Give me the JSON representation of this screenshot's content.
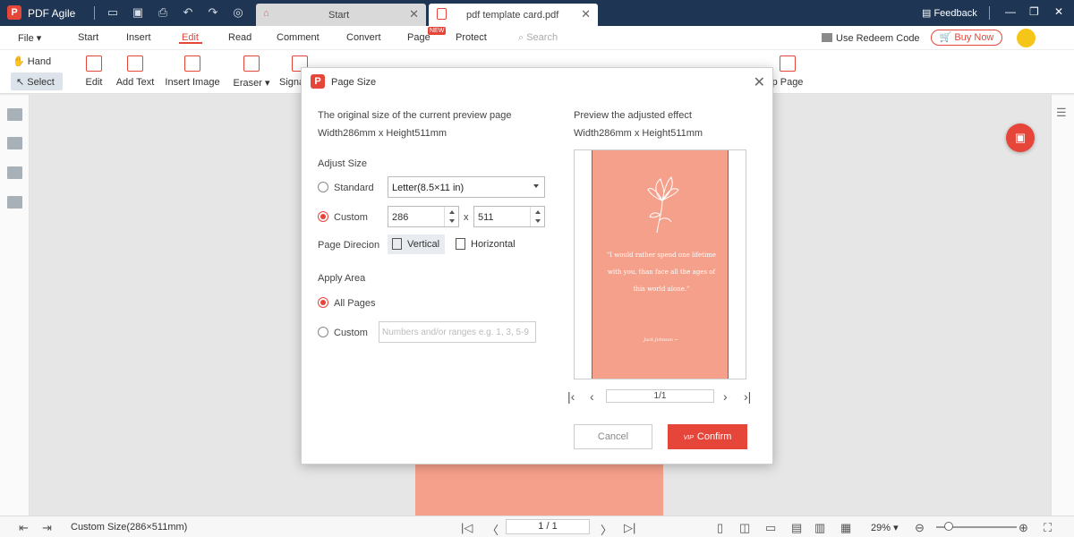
{
  "app": {
    "name": "PDF Agile",
    "logo": "P"
  },
  "tabs": [
    {
      "label": "Start"
    },
    {
      "label": "pdf template card.pdf"
    }
  ],
  "titlebar": {
    "feedback_label": "Feedback"
  },
  "menu": {
    "items": [
      "File",
      "Start",
      "Insert",
      "Edit",
      "Read",
      "Comment",
      "Convert",
      "Page",
      "Protect"
    ],
    "active": "Edit",
    "new_badge": "NEW",
    "search_placeholder": "Search",
    "redeem_label": "Use Redeem Code",
    "buy_label": "Buy Now"
  },
  "toolbar": {
    "hand_label": "Hand",
    "select_label": "Select",
    "tools": [
      "Edit",
      "Add Text",
      "Insert Image",
      "Eraser",
      "Signa",
      "p Page"
    ]
  },
  "status": {
    "page_size": "Custom Size(286×511mm)",
    "page_indicator": "1 / 1",
    "zoom": "29%"
  },
  "dialog": {
    "title": "Page Size",
    "original_label": "The original size of the current preview page",
    "original_value": "Width286mm x Height511mm",
    "adjust_label": "Adjust Size",
    "standard_label": "Standard",
    "standard_value": "Letter(8.5×11 in)",
    "custom_label": "Custom",
    "width_value": "286",
    "height_value": "511",
    "times": "x",
    "direction_label": "Page Direcion",
    "vertical_label": "Vertical",
    "horizontal_label": "Horizontal",
    "apply_label": "Apply Area",
    "all_pages_label": "All Pages",
    "custom_area_label": "Custom",
    "range_placeholder": "Numbers and/or ranges e.g. 1, 3, 5-9",
    "preview_label": "Preview the adjusted effect",
    "preview_value": "Width286mm x Height511mm",
    "quote": "\"I would rather spend one lifetime with you, than face all the ages of this world alone.\"",
    "author": "Jack Johnson ~",
    "preview_page": "1/1",
    "cancel_label": "Cancel",
    "confirm_label": "Confirm",
    "vip": "VIP"
  },
  "colors": {
    "accent": "#e6453a",
    "titlebar": "#1e3553",
    "page": "#f5a08a"
  }
}
